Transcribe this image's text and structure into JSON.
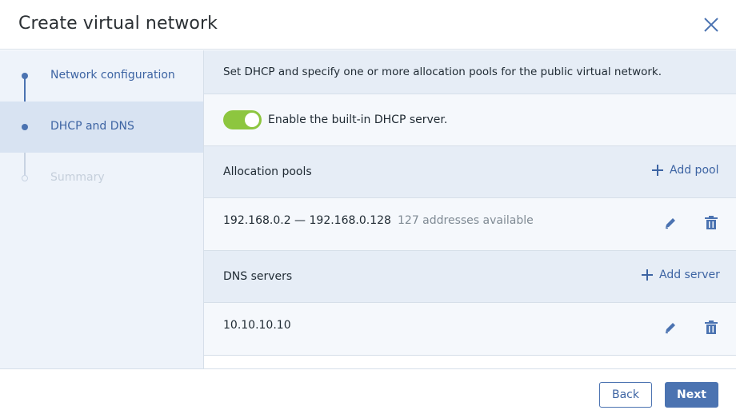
{
  "dialog": {
    "title": "Create virtual network",
    "close_icon": "close-icon"
  },
  "steps": [
    {
      "label": "Network configuration",
      "state": "completed",
      "color": "#3d64a3"
    },
    {
      "label": "DHCP and DNS",
      "state": "active",
      "color": "#3d64a3"
    },
    {
      "label": "Summary",
      "state": "pending",
      "color": "#c5cfdb"
    }
  ],
  "main": {
    "intro": "Set DHCP and specify one or more allocation pools for the public virtual network.",
    "dhcp": {
      "label": "Enable the built-in DHCP server.",
      "enabled": true,
      "toggle_color": "#8dc63f"
    },
    "allocation_pools": {
      "title": "Allocation pools",
      "add_label": "Add pool",
      "items": [
        {
          "range": "192.168.0.2 — 192.168.0.128",
          "info": "127 addresses available"
        }
      ]
    },
    "dns_servers": {
      "title": "DNS servers",
      "add_label": "Add server",
      "items": [
        {
          "address": "10.10.10.10"
        }
      ]
    }
  },
  "footer": {
    "back_label": "Back",
    "next_label": "Next"
  },
  "colors": {
    "accent": "#4b73b1",
    "link": "#3d64a3",
    "sidebar_bg": "#eef3fa",
    "active_step_bg": "#d8e3f2",
    "section_bg": "#e6edf6"
  },
  "icons": [
    "close-icon",
    "plus-icon",
    "pencil-icon",
    "trash-icon"
  ]
}
